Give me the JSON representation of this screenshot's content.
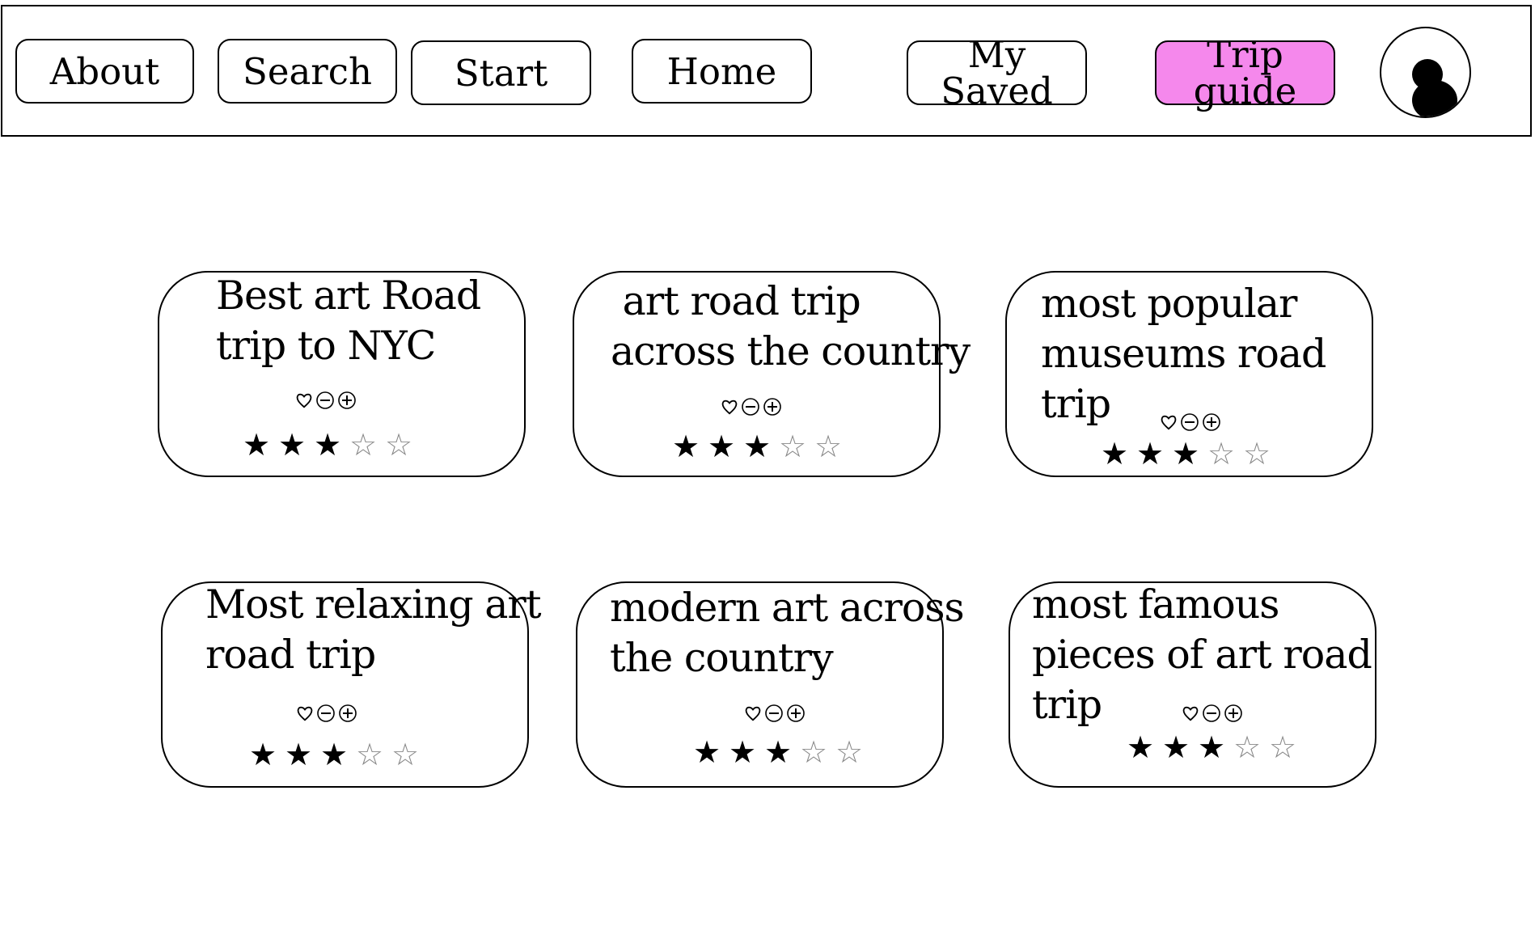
{
  "nav": {
    "about_label": "About",
    "search_label": "Search",
    "start_label": "Start",
    "home_label": "Home",
    "my_saved_label": "My Saved",
    "trip_guide_label": "Trip guide",
    "active_color": "#f588ec"
  },
  "profile": {
    "icon": "user-avatar-icon"
  },
  "cards": [
    {
      "title_lines": [
        "Best art Road",
        "trip to NYC"
      ],
      "rating": 3,
      "max_rating": 5
    },
    {
      "title_lines": [
        " art road trip",
        "across the country"
      ],
      "rating": 3,
      "max_rating": 5
    },
    {
      "title_lines": [
        "most popular",
        "museums road",
        "trip"
      ],
      "rating": 3,
      "max_rating": 5
    },
    {
      "title_lines": [
        "Most relaxing art",
        "road trip"
      ],
      "rating": 3,
      "max_rating": 5
    },
    {
      "title_lines": [
        "modern art across",
        "the country"
      ],
      "rating": 3,
      "max_rating": 5
    },
    {
      "title_lines": [
        "most famous",
        "pieces of art road",
        "trip"
      ],
      "rating": 3,
      "max_rating": 5
    }
  ],
  "icons": {
    "like": "heart-icon",
    "remove": "minus-circle-icon",
    "add": "plus-circle-icon",
    "star_filled": "★",
    "star_empty": "☆"
  }
}
